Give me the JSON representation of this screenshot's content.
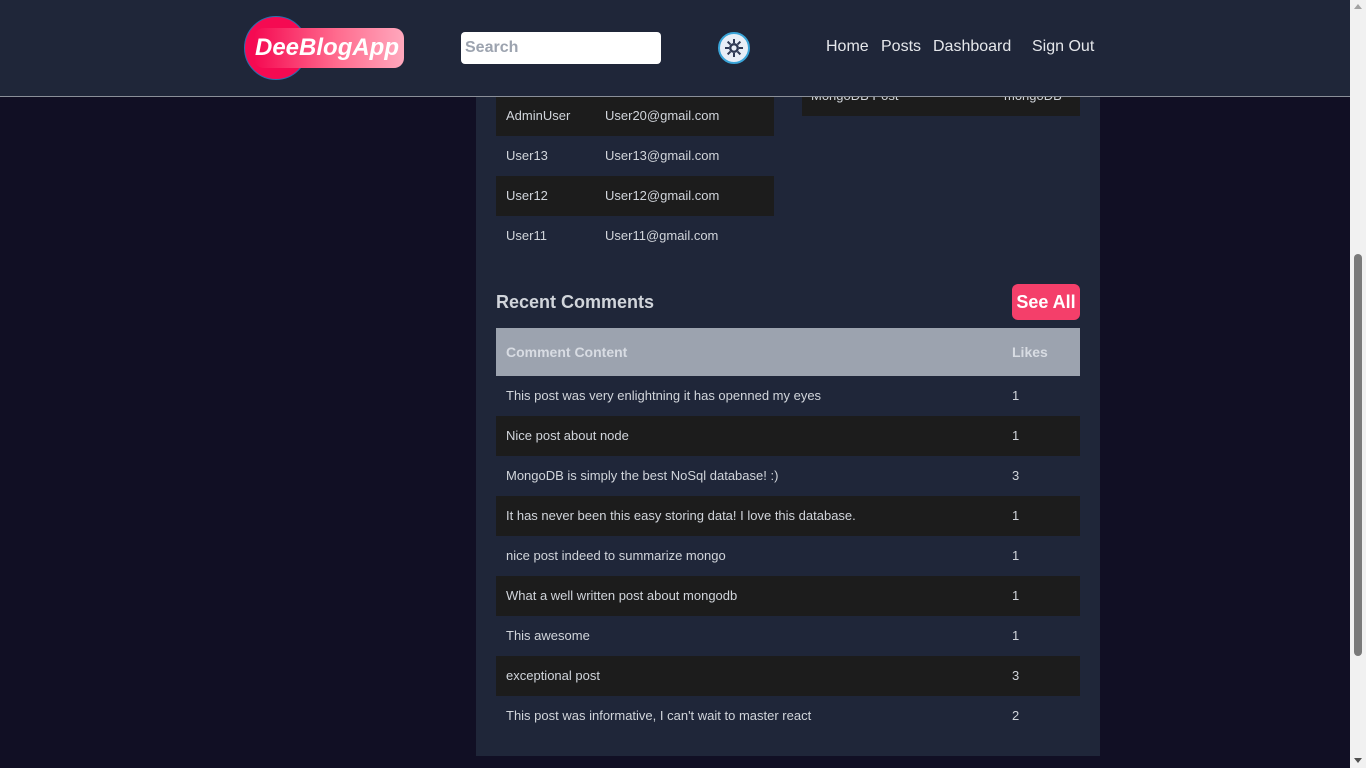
{
  "brand": {
    "name": "DeeBlogApp"
  },
  "search": {
    "placeholder": "Search"
  },
  "nav": {
    "home": "Home",
    "posts": "Posts",
    "dashboard": "Dashboard",
    "sign_out": "Sign Out"
  },
  "recent_users": {
    "rows": [
      {
        "username": "AdminUser",
        "email": "User20@gmail.com"
      },
      {
        "username": "User13",
        "email": "User13@gmail.com"
      },
      {
        "username": "User12",
        "email": "User12@gmail.com"
      },
      {
        "username": "User11",
        "email": "User11@gmail.com"
      }
    ]
  },
  "recent_posts": {
    "rows": [
      {
        "title": "MongoDB Post",
        "category": "mongoDB"
      }
    ]
  },
  "recent_comments": {
    "title": "Recent Comments",
    "see_all": "See All",
    "headers": {
      "content": "Comment Content",
      "likes": "Likes"
    },
    "rows": [
      {
        "content": "This post was very enlightning it has openned my eyes",
        "likes": "1"
      },
      {
        "content": "Nice post about node",
        "likes": "1"
      },
      {
        "content": "MongoDB is simply the best NoSql database! :)",
        "likes": "3"
      },
      {
        "content": "It has never been this easy storing data! I love this database.",
        "likes": "1"
      },
      {
        "content": "nice post indeed to summarize mongo",
        "likes": "1"
      },
      {
        "content": "What a well written post about mongodb",
        "likes": "1"
      },
      {
        "content": "This awesome",
        "likes": "1"
      },
      {
        "content": "exceptional post",
        "likes": "3"
      },
      {
        "content": "This post was informative, I can't wait to master react",
        "likes": "2"
      }
    ]
  },
  "colors": {
    "page_bg": "#110f24",
    "panel_bg": "#1f2639",
    "header_bg": "#1f2639",
    "dark_row": "#1c1c1c",
    "accent": "#f43f6a",
    "table_header": "#9ca3af"
  },
  "icons": {
    "theme_toggle": "sun-icon"
  }
}
